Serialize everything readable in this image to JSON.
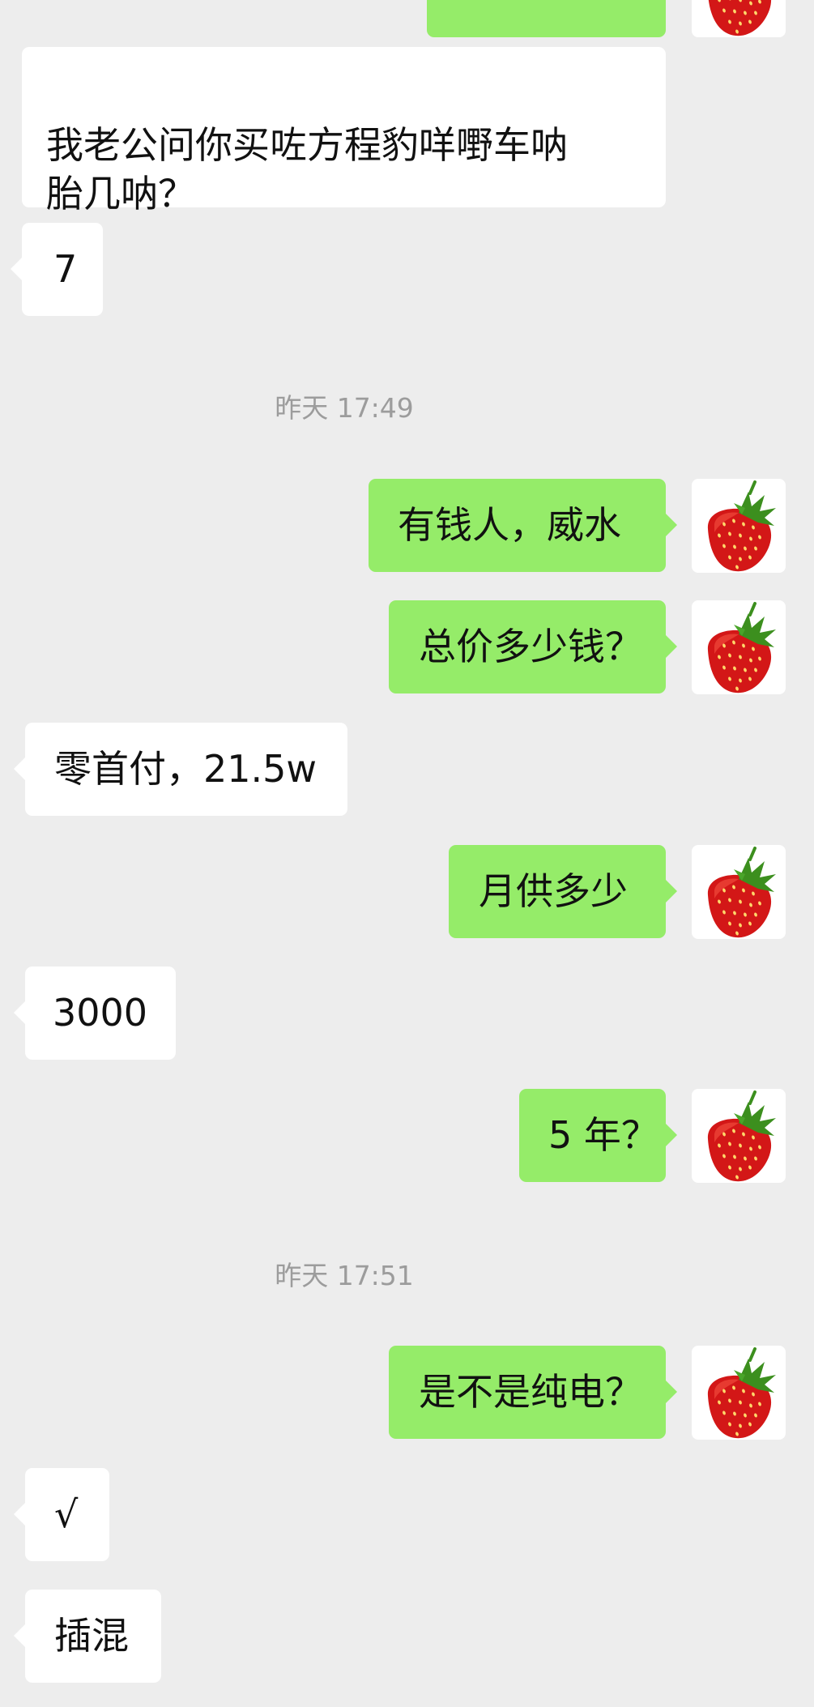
{
  "chat": {
    "messages": [
      {
        "from": "incoming",
        "text": "我老公问你买咗方程豹咩嘢车呐\n胎几呐？"
      },
      {
        "from": "incoming",
        "text": "7"
      },
      {
        "from": "outgoing",
        "text": "有钱人，威水"
      },
      {
        "from": "outgoing",
        "text": "总价多少钱？"
      },
      {
        "from": "incoming",
        "text": "零首付，21.5w"
      },
      {
        "from": "outgoing",
        "text": "月供多少"
      },
      {
        "from": "incoming",
        "text": "3000"
      },
      {
        "from": "outgoing",
        "text": "5 年？"
      },
      {
        "from": "outgoing",
        "text": "是不是纯电？"
      },
      {
        "from": "incoming",
        "text": "√"
      },
      {
        "from": "incoming",
        "text": "插混"
      }
    ],
    "timestamps": [
      "昨天 17:49",
      "昨天 17:51"
    ]
  },
  "avatar": {
    "icon": "strawberry-icon"
  },
  "colors": {
    "background": "#ededed",
    "incoming_bubble": "#ffffff",
    "outgoing_bubble": "#95ec69",
    "timestamp_text": "#9c9c9c"
  }
}
